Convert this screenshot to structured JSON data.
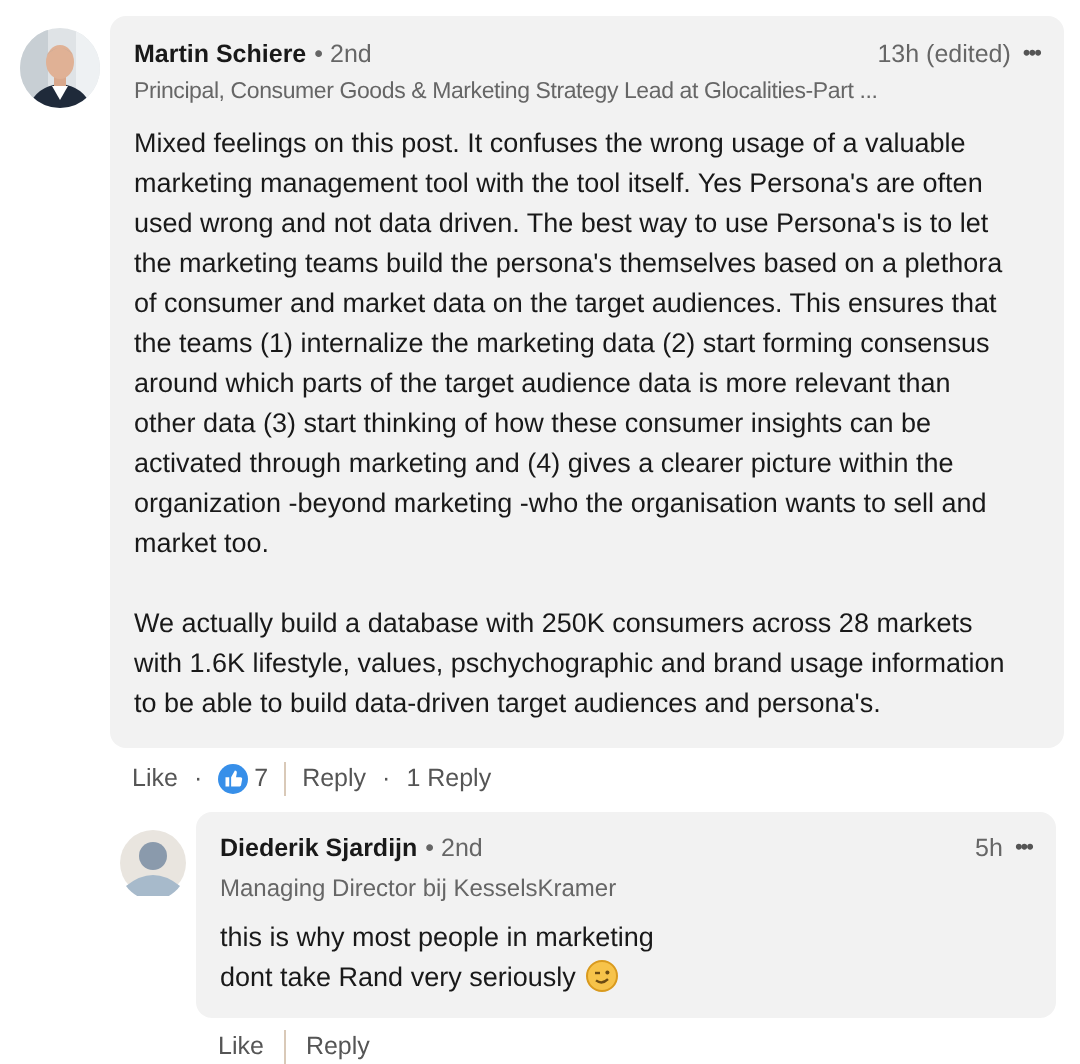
{
  "comment": {
    "author": "Martin Schiere",
    "degree": "• 2nd",
    "headline": "Principal, Consumer Goods & Marketing Strategy Lead at Glocalities-Part ...",
    "time": "13h (edited)",
    "menu": "•••",
    "paragraphs": [
      "Mixed feelings on this post. It confuses the wrong usage of a valuable\nmarketing management tool with the tool itself. Yes Persona's are often\nused wrong and not data driven. The best way to use Persona's is to let\nthe marketing teams build the persona's themselves based on a plethora\nof consumer and market data on the target audiences. This ensures that\nthe teams (1) internalize the marketing data (2) start forming consensus\naround which parts of the target audience data is more relevant than\nother data (3) start thinking of how these consumer insights can be\nactivated through marketing and (4) gives a clearer picture within the\norganization -beyond marketing -who the organisation wants to sell and\nmarket too.",
      "We actually build a database with 250K consumers across 28 markets\nwith 1.6K lifestyle, values,  pschychographic and brand usage information\nto be able to build data-driven target audiences and persona's."
    ],
    "actions": {
      "like": "Like",
      "dot1": "·",
      "reactions": "7",
      "reply": "Reply",
      "dot2": "·",
      "replies": "1 Reply"
    }
  },
  "reply": {
    "author": "Diederik Sjardijn",
    "degree": "• 2nd",
    "headline": "Managing Director bij KesselsKramer",
    "time": "5h",
    "menu": "•••",
    "text_lines": [
      "this is why most people in marketing",
      "dont take Rand very seriously"
    ],
    "actions": {
      "like": "Like",
      "reply": "Reply"
    }
  }
}
